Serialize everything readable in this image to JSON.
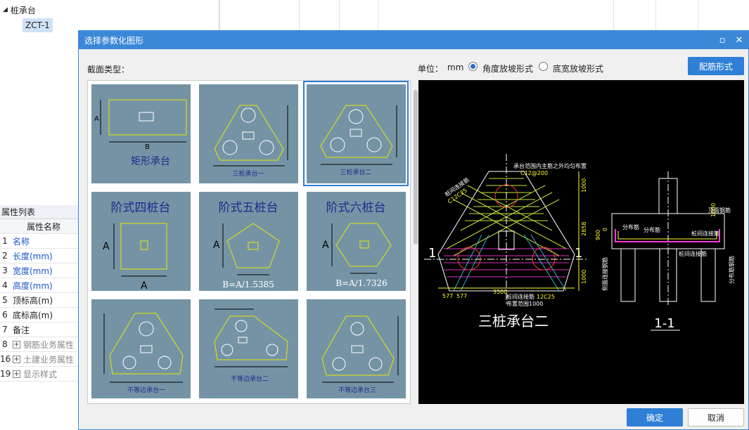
{
  "tree": {
    "root_label": "桩承台",
    "child_label": "ZCT-1"
  },
  "properties": {
    "title": "属性列表",
    "header": "属性名称",
    "rows": [
      {
        "num": "1",
        "name": "名称"
      },
      {
        "num": "2",
        "name": "长度(mm)"
      },
      {
        "num": "3",
        "name": "宽度(mm)"
      },
      {
        "num": "4",
        "name": "高度(mm)"
      },
      {
        "num": "5",
        "name": "顶标高(m)"
      },
      {
        "num": "6",
        "name": "底标高(m)"
      },
      {
        "num": "7",
        "name": "备注"
      },
      {
        "num": "8",
        "name": "钢筋业务属性"
      },
      {
        "num": "16",
        "name": "土建业务属性"
      },
      {
        "num": "19",
        "name": "显示样式"
      }
    ]
  },
  "dialog": {
    "title": "选择参数化图形",
    "section_label": "截面类型：",
    "unit_label": "单位：",
    "unit_value": "mm",
    "radio_angle": "角度放坡形式",
    "radio_width": "底宽放坡形式",
    "rebar_button": "配筋形式",
    "ok_button": "确定",
    "cancel_button": "取消"
  },
  "gallery": {
    "items": [
      {
        "label": "矩形承台",
        "dim_a": "A",
        "dim_b": "B"
      },
      {
        "label": "三桩承台一"
      },
      {
        "label": "三桩承台二"
      },
      {
        "label": "阶式四桩台",
        "dim_a": "A",
        "dim_b": "A"
      },
      {
        "label": "阶式五桩台",
        "dim_a": "A",
        "formula": "B=A/1.5385"
      },
      {
        "label": "阶式六桩台",
        "dim_a": "A",
        "formula": "B=A/1.7326"
      },
      {
        "label": "不等边承台一"
      },
      {
        "label": "不等边承台二"
      },
      {
        "label": "不等边承台三"
      }
    ]
  },
  "preview": {
    "main_title": "三桩承台二",
    "section_title": "1-1",
    "section_mark": "1",
    "note_top": "承台范围内主筋之外均匀布置",
    "bar_top": "C12@200",
    "note_side": "桩间连接筋",
    "bar_side": "C12C25",
    "note_bottom1": "桩间连接筋",
    "bar_bottom": "12C25",
    "note_bottom2": "布置范围1000",
    "dim_left": "577",
    "dim_left2": "577",
    "dim_bottom": "3500",
    "dim_v1": "1000",
    "dim_v2": "2858",
    "dim_v3": "1000",
    "dim_900": "900",
    "dim_0": "0",
    "sec_label1": "分布筋",
    "sec_label2": "分布筋",
    "sec_label3": "桩间连接筋",
    "sec_label4": "桩间连接筋",
    "sec_label5": "顶面钢筋",
    "sec_label6": "1000",
    "sec_side_left": "侧面连接钢筋",
    "sec_side_right": "分布筋钢筋"
  }
}
